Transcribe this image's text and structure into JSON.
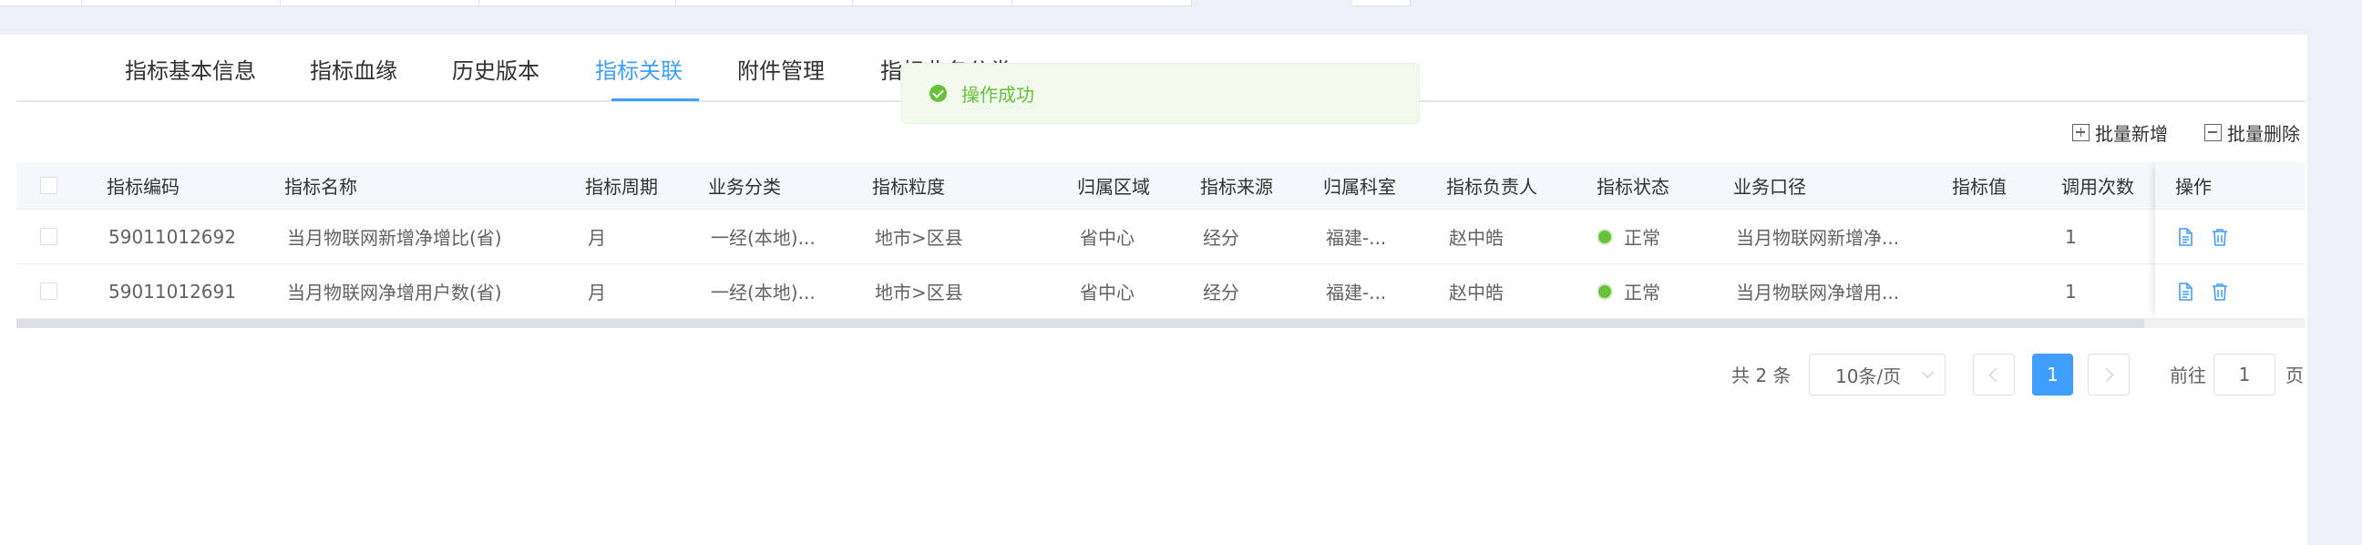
{
  "tabs": [
    {
      "label": "指标基本信息"
    },
    {
      "label": "指标血缘"
    },
    {
      "label": "历史版本"
    },
    {
      "label": "指标关联"
    },
    {
      "label": "附件管理"
    },
    {
      "label": "指标业务分类"
    }
  ],
  "active_tab": "指标关联",
  "toast": {
    "message": "操作成功"
  },
  "toolbar": {
    "batch_add": "批量新增",
    "batch_delete": "批量删除"
  },
  "table": {
    "headers": [
      "指标编码",
      "指标名称",
      "指标周期",
      "业务分类",
      "指标粒度",
      "归属区域",
      "指标来源",
      "归属科室",
      "指标负责人",
      "指标状态",
      "业务口径",
      "指标值",
      "调用次数",
      "操作"
    ],
    "rows": [
      {
        "code": "59011012692",
        "name": "当月物联网新增净增比(省)",
        "period": "月",
        "category": "一经(本地)...",
        "granularity": "地市>区县",
        "region": "省中心",
        "source": "经分",
        "dept": "福建-...",
        "owner": "赵中皓",
        "status": "正常",
        "caliber": "当月物联网新增净...",
        "value": "",
        "calls": "1"
      },
      {
        "code": "59011012691",
        "name": "当月物联网净增用户数(省)",
        "period": "月",
        "category": "一经(本地)...",
        "granularity": "地市>区县",
        "region": "省中心",
        "source": "经分",
        "dept": "福建-...",
        "owner": "赵中皓",
        "status": "正常",
        "caliber": "当月物联网净增用...",
        "value": "",
        "calls": "1"
      }
    ]
  },
  "pagination": {
    "total_text": "共 2 条",
    "page_size": "10条/页",
    "current_page": "1",
    "goto_label": "前往",
    "goto_value": "1",
    "page_suffix": "页"
  },
  "colors": {
    "accent": "#409eff",
    "success": "#67c23a"
  }
}
